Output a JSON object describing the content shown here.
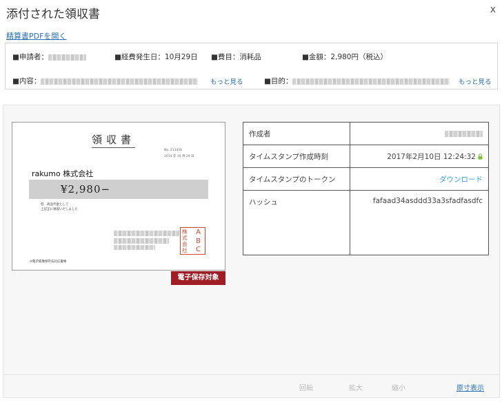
{
  "dialog": {
    "title": "添付された領収書",
    "close_label": "x",
    "pdf_link": "精算書PDFを開く"
  },
  "info": {
    "applicant_label": "■申請者：",
    "expense_date_label": "■経費発生日：",
    "expense_date_value": "10月29日",
    "category_label": "■費目：",
    "category_value": "消耗品",
    "amount_label": "■金額：",
    "amount_value": "2,980円（税込）",
    "content_label": "■内容：",
    "content_more": "もっと見る",
    "purpose_label": "■目的：",
    "purpose_more": "もっと見る"
  },
  "receipt": {
    "title": "領収書",
    "number_line": "No. 213456",
    "date_line": "2014 年 10 月 29 日",
    "company": "rakumo 株式会社",
    "amount": "¥2,980−",
    "note_line1": "但　商品代金として",
    "note_line2": "上記正に領収いたしました",
    "footer_note": "※電子帳簿保存法対応書類",
    "stamp_left": "株式会社",
    "stamp_right": "ABC",
    "badge": "電子保存対象"
  },
  "meta_table": {
    "rows": [
      {
        "key": "作成者",
        "value": ""
      },
      {
        "key": "タイムスタンプ作成時刻",
        "value": "2017年2月10日 12:24:32"
      },
      {
        "key": "タイムスタンプのトークン",
        "value": "ダウンロード"
      },
      {
        "key": "ハッシュ",
        "value": "fafaad34asddd33a3sfadfasdfc"
      }
    ]
  },
  "toolbar": {
    "rotate": "回転",
    "zoom_in": "拡大",
    "zoom_out": "縮小",
    "actual_size": "原寸表示"
  },
  "colors": {
    "link": "#2a6fb0",
    "download": "#3aa0d8",
    "badge_bg": "#a11d26",
    "stamp": "#c8492e",
    "lock": "#7cbf3a"
  }
}
